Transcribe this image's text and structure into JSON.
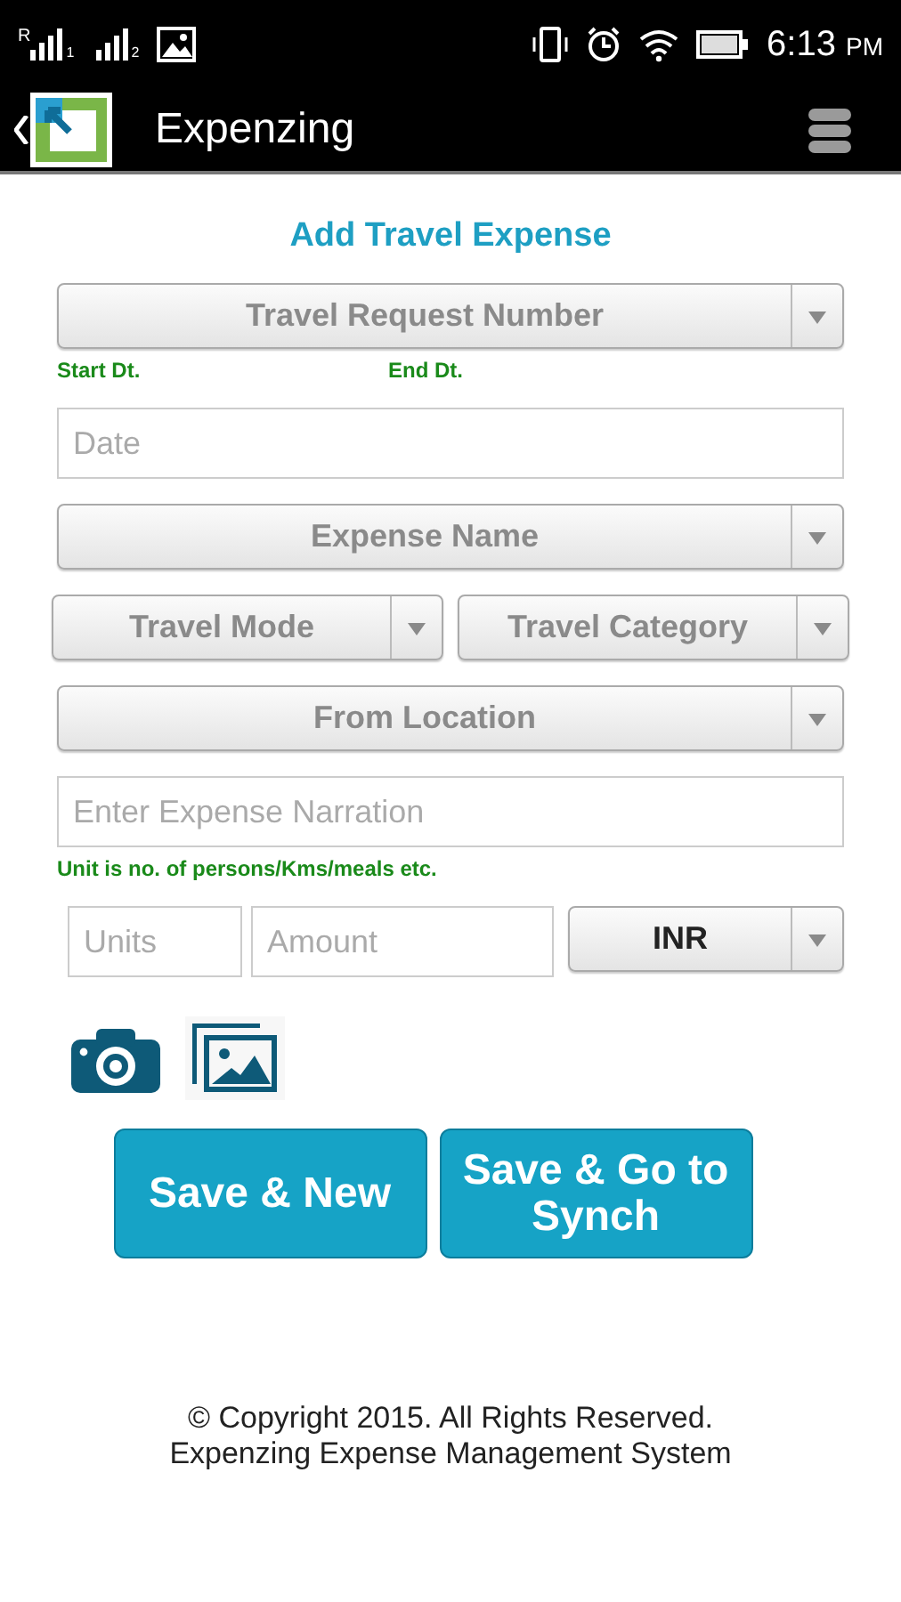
{
  "status_bar": {
    "sims": [
      {
        "prefix": "R",
        "slot": "1"
      },
      {
        "slot": "2"
      }
    ],
    "time": "6:13",
    "meridiem": "PM"
  },
  "app_bar": {
    "title": "Expenzing"
  },
  "form": {
    "title": "Add Travel Expense",
    "travel_request": {
      "label": "Travel Request Number"
    },
    "date_labels": [
      "Start Dt.",
      "End Dt."
    ],
    "date": {
      "placeholder": "Date"
    },
    "expense_name": {
      "label": "Expense Name"
    },
    "travel_mode": {
      "label": "Travel Mode"
    },
    "travel_category": {
      "label": "Travel Category"
    },
    "from_location": {
      "label": "From Location"
    },
    "narration": {
      "placeholder": "Enter Expense Narration"
    },
    "unit_hint": "Unit is no. of persons/Kms/meals etc.",
    "units": {
      "placeholder": "Units"
    },
    "amount": {
      "placeholder": "Amount"
    },
    "currency": {
      "label": "INR"
    }
  },
  "buttons": [
    {
      "label": "Save & New"
    },
    {
      "label": "Save & Go to Synch"
    }
  ],
  "footer": [
    "© Copyright 2015. All Rights Reserved.",
    "Expenzing Expense Management System"
  ]
}
